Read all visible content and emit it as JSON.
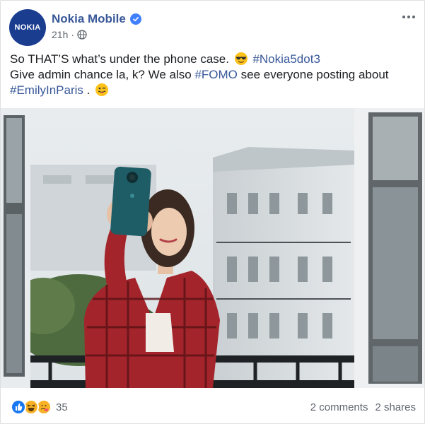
{
  "post": {
    "page_name": "Nokia Mobile",
    "avatar_text": "NOKIA",
    "time": "21h",
    "separator": "·",
    "text": {
      "line1_a": "So THAT’S what’s under the phone case.",
      "line1_tag": "#Nokia5dot3",
      "line2_a": "Give admin chance la, k? We also",
      "line2_tag": "#FOMO",
      "line2_b": "see everyone posting about",
      "line3_tag": "#EmilyInParis",
      "line3_b": "."
    },
    "icons": {
      "verified": "verified-badge-icon",
      "audience": "globe-icon",
      "menu": "more-options-icon",
      "emoji_sunglasses": "sunglasses-emoji",
      "emoji_wink": "winking-tongue-emoji"
    }
  },
  "footer": {
    "reaction_count": "35",
    "comments": "2 comments",
    "shares": "2 shares"
  },
  "colors": {
    "brand_blue": "#385898",
    "like_blue": "#1877f2",
    "haha_yellow": "#f7b125",
    "text_gray": "#606770"
  }
}
